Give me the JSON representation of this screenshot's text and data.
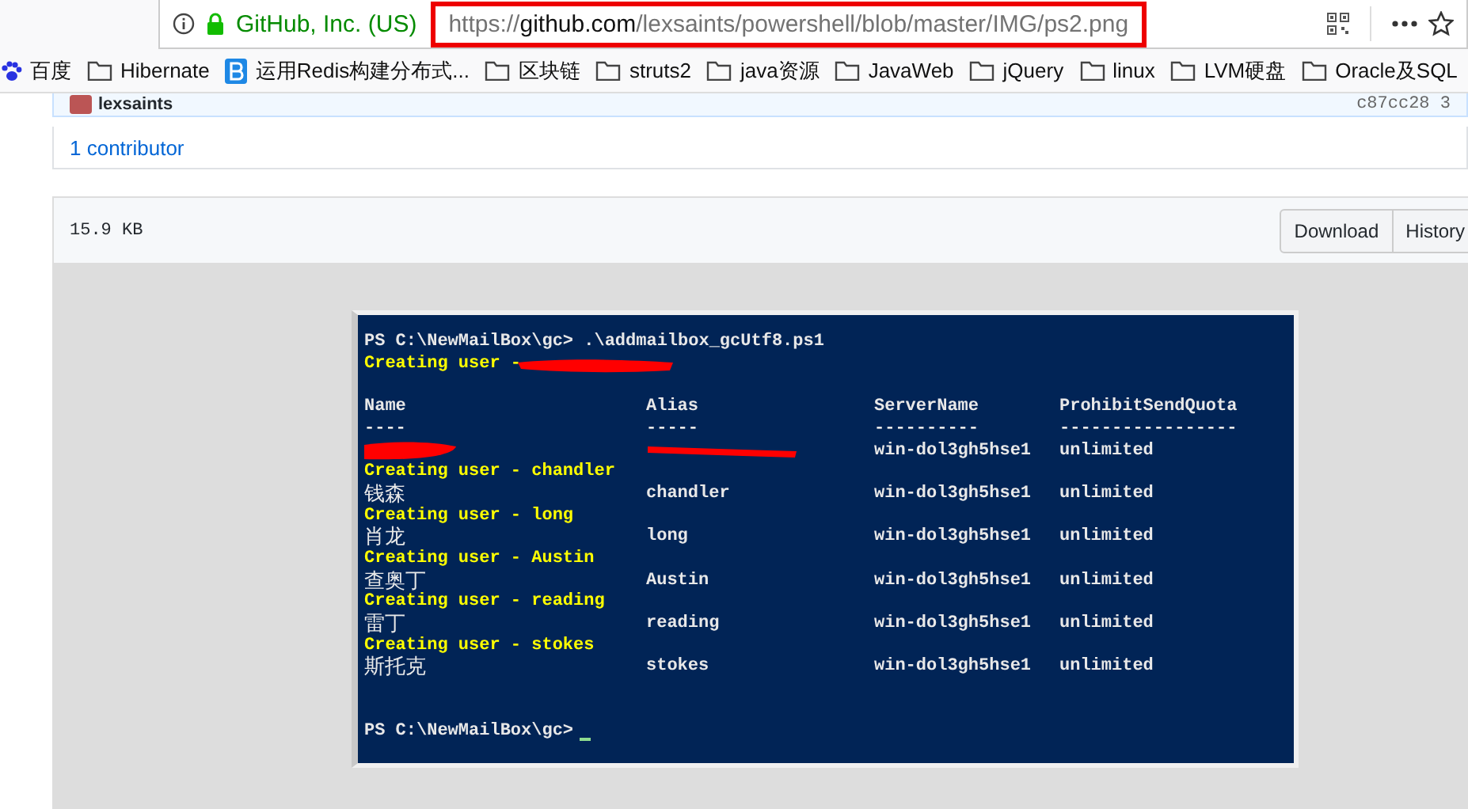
{
  "address_bar": {
    "identity": "GitHub, Inc. (US)",
    "url_scheme": "https://",
    "url_host": "github.com",
    "url_path": "/lexsaints/powershell/blob/master/IMG/ps2.png",
    "highlighted": true
  },
  "bookmarks": [
    {
      "kind": "paw",
      "label": "百度"
    },
    {
      "kind": "folder",
      "label": "Hibernate"
    },
    {
      "kind": "b",
      "label": "运用Redis构建分布式..."
    },
    {
      "kind": "folder",
      "label": "区块链"
    },
    {
      "kind": "folder",
      "label": "struts2"
    },
    {
      "kind": "folder",
      "label": "java资源"
    },
    {
      "kind": "folder",
      "label": "JavaWeb"
    },
    {
      "kind": "folder",
      "label": "jQuery"
    },
    {
      "kind": "folder",
      "label": "linux"
    },
    {
      "kind": "folder",
      "label": "LVM硬盘"
    },
    {
      "kind": "folder",
      "label": "Oracle及SQL"
    }
  ],
  "commit": {
    "author": "lexsaints",
    "sha": "c87cc28 3"
  },
  "contributors": {
    "count": "1",
    "label": "contributor"
  },
  "file": {
    "size": "15.9 KB",
    "buttons": [
      "Download",
      "History"
    ]
  },
  "console": {
    "lines": [
      {
        "kind": "prompt",
        "text": "PS C:\\NewMailBox\\gc> .\\addmailbox_gcUtf8.ps1",
        "cursor": false
      },
      {
        "kind": "creating",
        "text": "Creating user - ",
        "redacted": true
      },
      {
        "kind": "blank"
      },
      {
        "kind": "header",
        "cells": [
          "Name",
          "Alias",
          "ServerName",
          "ProhibitSendQuota"
        ]
      },
      {
        "kind": "dashes",
        "cells": [
          "----",
          "-----",
          "----------",
          "-----------------"
        ]
      },
      {
        "kind": "row",
        "redacted": true,
        "server": "win-dol3gh5hse1",
        "quota": "unlimited"
      },
      {
        "kind": "creating",
        "text": "Creating user - chandler",
        "redacted": false
      },
      {
        "kind": "row",
        "name": "钱森",
        "alias": "chandler",
        "redacted": false,
        "server": "win-dol3gh5hse1",
        "quota": "unlimited"
      },
      {
        "kind": "creating",
        "text": "Creating user - long",
        "redacted": false
      },
      {
        "kind": "row",
        "name": "肖龙",
        "alias": "long",
        "redacted": false,
        "server": "win-dol3gh5hse1",
        "quota": "unlimited"
      },
      {
        "kind": "creating",
        "text": "Creating user - Austin",
        "redacted": false
      },
      {
        "kind": "row",
        "name": "查奥丁",
        "alias": "Austin",
        "redacted": false,
        "server": "win-dol3gh5hse1",
        "quota": "unlimited"
      },
      {
        "kind": "creating",
        "text": "Creating user - reading",
        "redacted": false
      },
      {
        "kind": "row",
        "name": "雷丁",
        "alias": "reading",
        "redacted": false,
        "server": "win-dol3gh5hse1",
        "quota": "unlimited"
      },
      {
        "kind": "creating",
        "text": "Creating user - stokes",
        "redacted": false
      },
      {
        "kind": "row",
        "name": "斯托克",
        "alias": "stokes",
        "redacted": false,
        "server": "win-dol3gh5hse1",
        "quota": "unlimited"
      },
      {
        "kind": "blank"
      },
      {
        "kind": "blank"
      },
      {
        "kind": "prompt",
        "text": "PS C:\\NewMailBox\\gc> ",
        "cursor": true
      }
    ]
  }
}
